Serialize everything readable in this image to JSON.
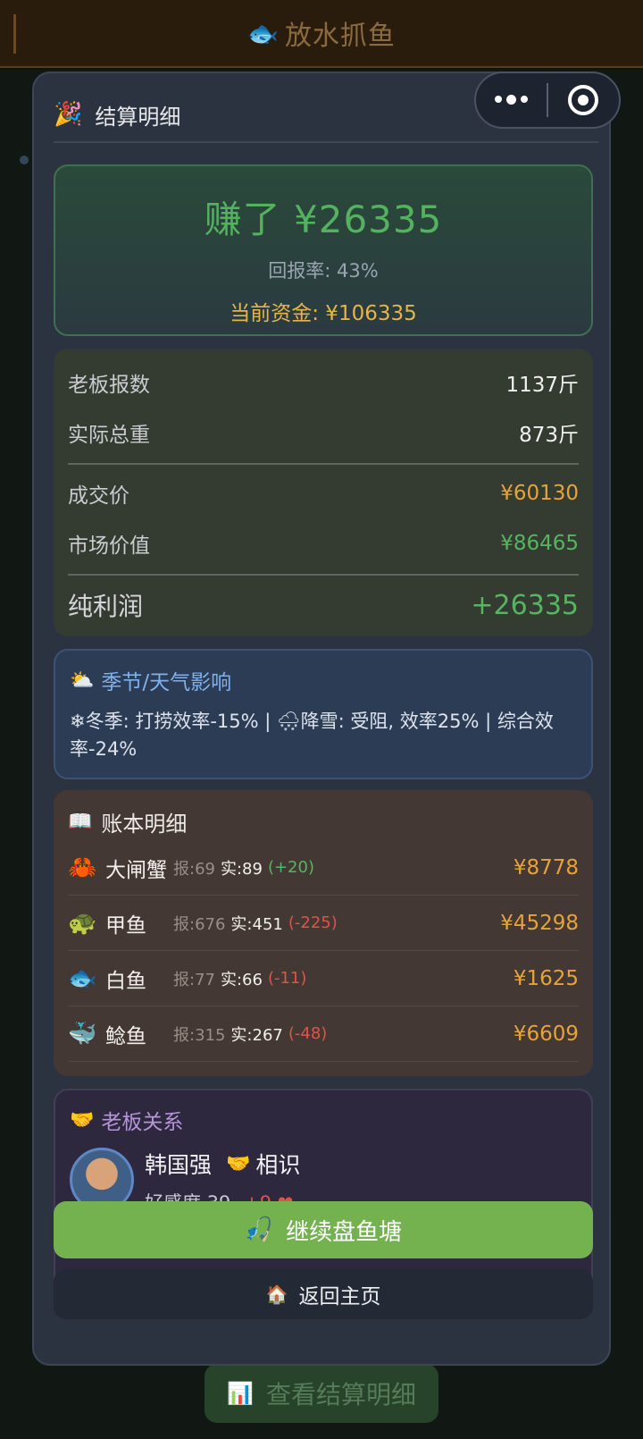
{
  "topbar": {
    "title": "放水抓鱼",
    "icon": "🐟"
  },
  "modal": {
    "title": "结算明细",
    "title_icon": "🎉"
  },
  "summary": {
    "earned": "赚了 ¥26335",
    "return_rate": "回报率: 43%",
    "current_funds": "当前资金: ¥106335"
  },
  "stats": {
    "boss_reported_label": "老板报数",
    "boss_reported_value": "1137斤",
    "actual_weight_label": "实际总重",
    "actual_weight_value": "873斤",
    "deal_price_label": "成交价",
    "deal_price_value": "¥60130",
    "market_value_label": "市场价值",
    "market_value_value": "¥86465",
    "net_profit_label": "纯利润",
    "net_profit_value": "+26335"
  },
  "weather": {
    "icon": "⛅",
    "title": "季节/天气影响",
    "text": "❄冬季: 打捞效率-15% | 🌨降雪: 受阻, 效率25% | 综合效率-24%"
  },
  "ledger": {
    "icon": "📖",
    "title": "账本明细",
    "rows": [
      {
        "icon": "🦀",
        "name": "大闸蟹",
        "reported": "报:69",
        "actual": "实:89",
        "diff": "(+20)",
        "diff_type": "pos",
        "amount": "¥8778"
      },
      {
        "icon": "🐢",
        "name": "甲鱼",
        "reported": "报:676",
        "actual": "实:451",
        "diff": "(-225)",
        "diff_type": "neg",
        "amount": "¥45298"
      },
      {
        "icon": "🐟",
        "name": "白鱼",
        "reported": "报:77",
        "actual": "实:66",
        "diff": "(-11)",
        "diff_type": "neg",
        "amount": "¥1625"
      },
      {
        "icon": "🐳",
        "name": "鲶鱼",
        "reported": "报:315",
        "actual": "实:267",
        "diff": "(-48)",
        "diff_type": "neg",
        "amount": "¥6609"
      }
    ]
  },
  "boss": {
    "icon": "🤝",
    "title": "老板关系",
    "name": "韩国强",
    "relation_icon": "🤝",
    "relation": "相识",
    "favor": "好感度 39",
    "favor_delta": "+9 ❤"
  },
  "buttons": {
    "continue_icon": "🎣",
    "continue_label": "继续盘鱼塘",
    "home_icon": "🏠",
    "home_label": "返回主页",
    "view_details_icon": "📊",
    "view_details_label": "查看结算明细"
  }
}
